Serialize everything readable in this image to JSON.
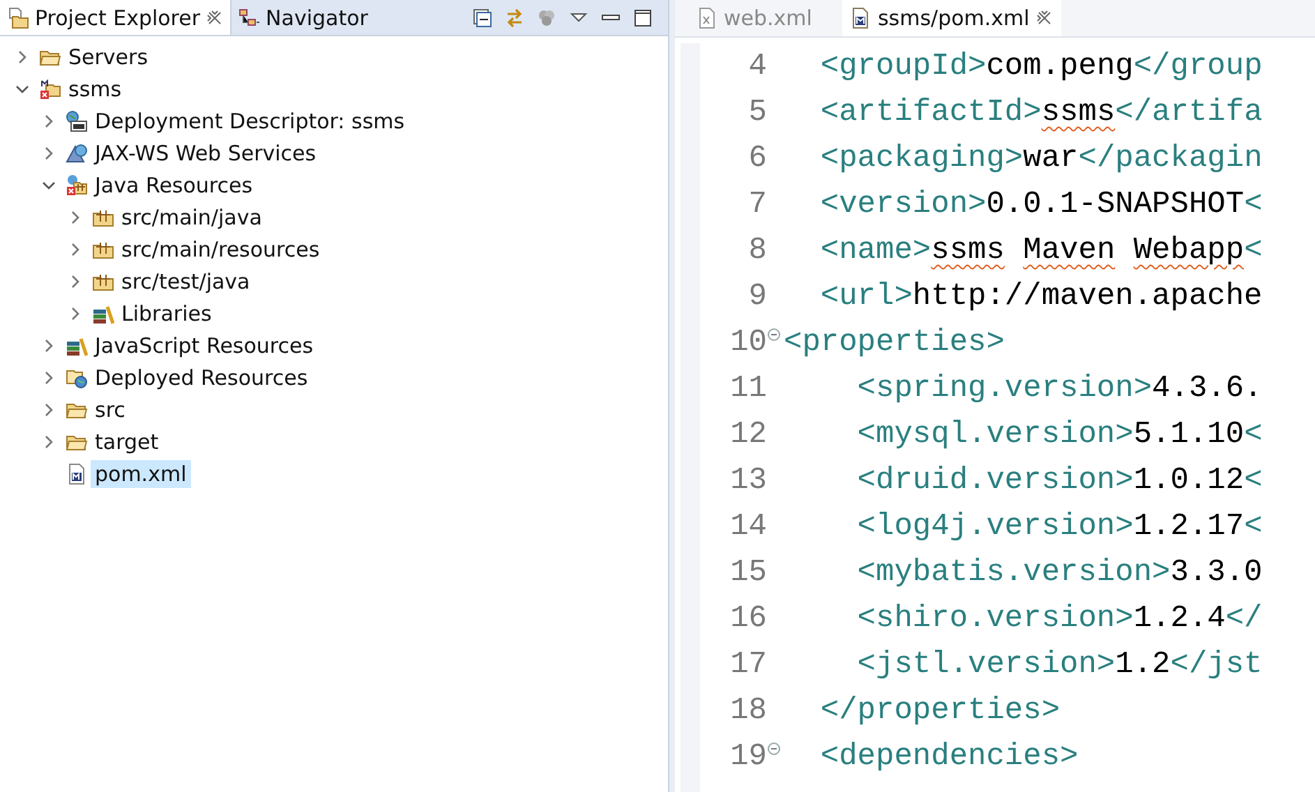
{
  "explorer": {
    "tabs": [
      {
        "label": "Project Explorer",
        "kind": "explorer",
        "selected": true
      },
      {
        "label": "Navigator",
        "kind": "navigator",
        "selected": false
      }
    ],
    "tree": [
      {
        "label": "Servers",
        "kind": "folder",
        "expanded": false,
        "selected": false
      },
      {
        "label": "ssms",
        "kind": "project",
        "expanded": true,
        "selected": false,
        "children": [
          {
            "label": "Deployment Descriptor: ssms",
            "kind": "descriptor",
            "expanded": false,
            "selected": false
          },
          {
            "label": "JAX-WS Web Services",
            "kind": "webservices",
            "expanded": false,
            "selected": false
          },
          {
            "label": "Java Resources",
            "kind": "java-resources",
            "expanded": true,
            "selected": false,
            "children": [
              {
                "label": "src/main/java",
                "kind": "package-folder",
                "expanded": false,
                "selected": false
              },
              {
                "label": "src/main/resources",
                "kind": "package-folder",
                "expanded": false,
                "selected": false
              },
              {
                "label": "src/test/java",
                "kind": "package-folder",
                "expanded": false,
                "selected": false
              },
              {
                "label": "Libraries",
                "kind": "library",
                "expanded": false,
                "selected": false
              }
            ]
          },
          {
            "label": "JavaScript Resources",
            "kind": "library",
            "expanded": false,
            "selected": false
          },
          {
            "label": "Deployed Resources",
            "kind": "deployed",
            "expanded": false,
            "selected": false
          },
          {
            "label": "src",
            "kind": "folder",
            "expanded": false,
            "selected": false
          },
          {
            "label": "target",
            "kind": "folder",
            "expanded": false,
            "selected": false
          },
          {
            "label": "pom.xml",
            "kind": "xml-file",
            "selected": true
          }
        ]
      }
    ]
  },
  "editor": {
    "tabs": [
      {
        "label": "web.xml",
        "kind": "xml",
        "selected": false
      },
      {
        "label": "ssms/pom.xml",
        "kind": "maven",
        "selected": true
      }
    ],
    "lines": [
      {
        "number": "4",
        "foldable": false,
        "segments": [
          {
            "kind": "tag",
            "text": "  <groupId>"
          },
          {
            "kind": "text",
            "text": "com.peng",
            "misspelled": false
          },
          {
            "kind": "tag",
            "text": "</group"
          }
        ]
      },
      {
        "number": "5",
        "foldable": false,
        "segments": [
          {
            "kind": "tag",
            "text": "  <artifactId>"
          },
          {
            "kind": "text",
            "text": "ssms",
            "misspelled": true
          },
          {
            "kind": "tag",
            "text": "</artifa"
          }
        ]
      },
      {
        "number": "6",
        "foldable": false,
        "segments": [
          {
            "kind": "tag",
            "text": "  <packaging>"
          },
          {
            "kind": "text",
            "text": "war",
            "misspelled": false
          },
          {
            "kind": "tag",
            "text": "</packagin"
          }
        ]
      },
      {
        "number": "7",
        "foldable": false,
        "segments": [
          {
            "kind": "tag",
            "text": "  <version>"
          },
          {
            "kind": "text",
            "text": "0.0.1-SNAPSHOT",
            "misspelled": false
          },
          {
            "kind": "tag",
            "text": "<"
          }
        ]
      },
      {
        "number": "8",
        "foldable": false,
        "segments": [
          {
            "kind": "tag",
            "text": "  <name>"
          },
          {
            "kind": "text",
            "text": "ssms Maven Webapp",
            "misspelled": true
          },
          {
            "kind": "tag",
            "text": "<"
          }
        ]
      },
      {
        "number": "9",
        "foldable": false,
        "segments": [
          {
            "kind": "tag",
            "text": "  <url>"
          },
          {
            "kind": "text",
            "text": "http://maven.apache",
            "misspelled": false
          }
        ]
      },
      {
        "number": "10",
        "foldable": true,
        "segments": [
          {
            "kind": "tag",
            "text": "<properties>"
          }
        ]
      },
      {
        "number": "11",
        "foldable": false,
        "segments": [
          {
            "kind": "tag",
            "text": "    <spring.version>"
          },
          {
            "kind": "text",
            "text": "4.3.6.",
            "misspelled": false
          }
        ]
      },
      {
        "number": "12",
        "foldable": false,
        "segments": [
          {
            "kind": "tag",
            "text": "    <mysql.version>"
          },
          {
            "kind": "text",
            "text": "5.1.10",
            "misspelled": false
          },
          {
            "kind": "tag",
            "text": "<"
          }
        ]
      },
      {
        "number": "13",
        "foldable": false,
        "segments": [
          {
            "kind": "tag",
            "text": "    <druid.version>"
          },
          {
            "kind": "text",
            "text": "1.0.12",
            "misspelled": false
          },
          {
            "kind": "tag",
            "text": "<"
          }
        ]
      },
      {
        "number": "14",
        "foldable": false,
        "segments": [
          {
            "kind": "tag",
            "text": "    <log4j.version>"
          },
          {
            "kind": "text",
            "text": "1.2.17",
            "misspelled": false
          },
          {
            "kind": "tag",
            "text": "<"
          }
        ]
      },
      {
        "number": "15",
        "foldable": false,
        "segments": [
          {
            "kind": "tag",
            "text": "    <mybatis.version>"
          },
          {
            "kind": "text",
            "text": "3.3.0",
            "misspelled": false
          }
        ]
      },
      {
        "number": "16",
        "foldable": false,
        "segments": [
          {
            "kind": "tag",
            "text": "    <shiro.version>"
          },
          {
            "kind": "text",
            "text": "1.2.4",
            "misspelled": false
          },
          {
            "kind": "tag",
            "text": "</"
          }
        ]
      },
      {
        "number": "17",
        "foldable": false,
        "segments": [
          {
            "kind": "tag",
            "text": "    <jstl.version>"
          },
          {
            "kind": "text",
            "text": "1.2",
            "misspelled": false
          },
          {
            "kind": "tag",
            "text": "</jst"
          }
        ]
      },
      {
        "number": "18",
        "foldable": false,
        "segments": [
          {
            "kind": "tag",
            "text": "  </properties>"
          }
        ]
      },
      {
        "number": "19",
        "foldable": true,
        "segments": [
          {
            "kind": "tag",
            "text": "  <dependencies>"
          }
        ]
      }
    ]
  }
}
